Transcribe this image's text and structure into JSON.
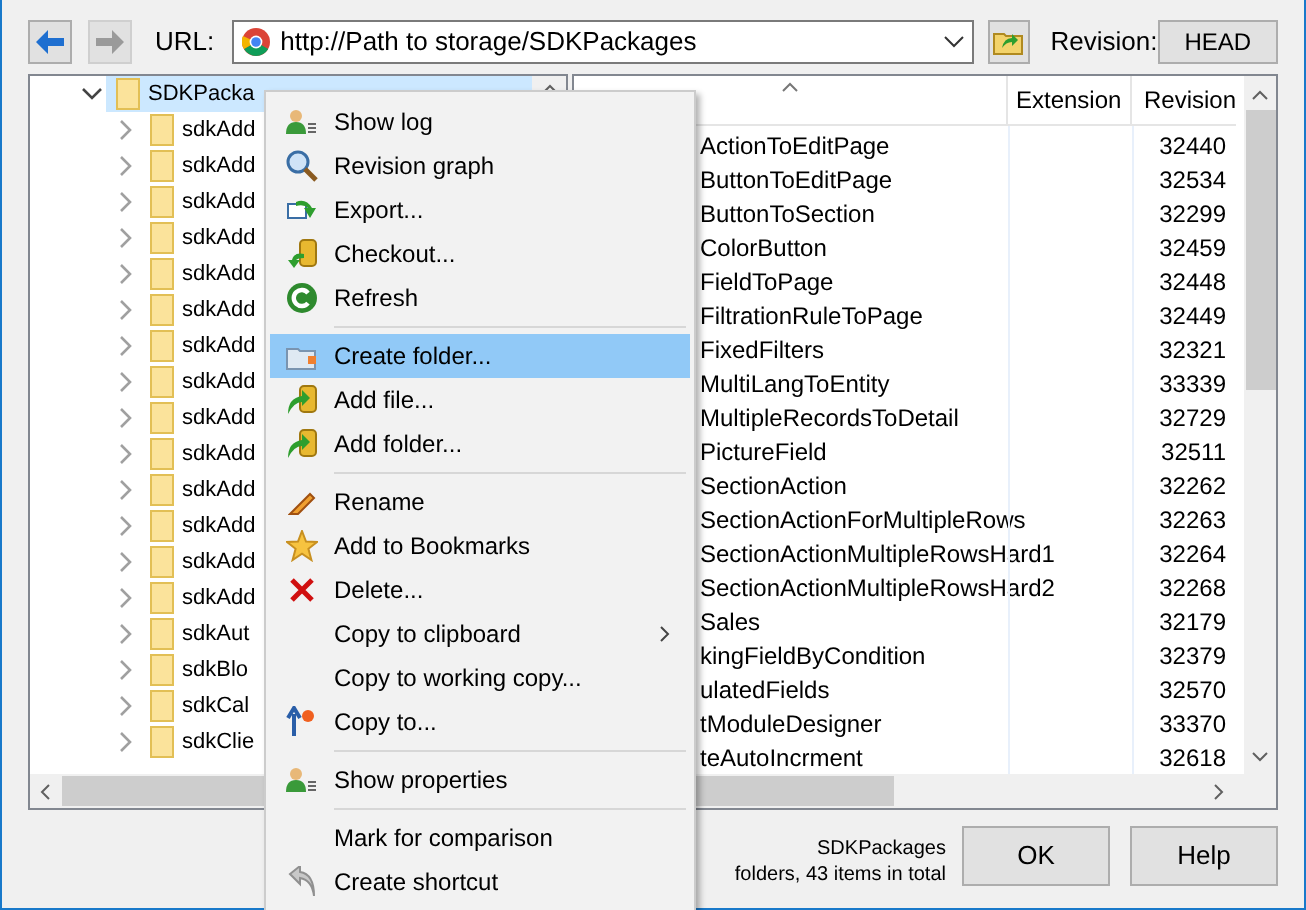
{
  "toolbar": {
    "url_label": "URL:",
    "url": "http://Path to storage/SDKPackages",
    "revision_label": "Revision:",
    "revision_button": "HEAD"
  },
  "tree": {
    "root": {
      "label": "SDKPacka",
      "expanded": true,
      "selected": true,
      "children": [
        {
          "label": "sdkAdd",
          "expanded": false,
          "selected": false
        },
        {
          "label": "sdkAdd",
          "expanded": false,
          "selected": false
        },
        {
          "label": "sdkAdd",
          "expanded": false,
          "selected": false
        },
        {
          "label": "sdkAdd",
          "expanded": false,
          "selected": false
        },
        {
          "label": "sdkAdd",
          "expanded": false,
          "selected": false
        },
        {
          "label": "sdkAdd",
          "expanded": false,
          "selected": false
        },
        {
          "label": "sdkAdd",
          "expanded": false,
          "selected": false
        },
        {
          "label": "sdkAdd",
          "expanded": false,
          "selected": false
        },
        {
          "label": "sdkAdd",
          "expanded": false,
          "selected": false
        },
        {
          "label": "sdkAdd",
          "expanded": false,
          "selected": false
        },
        {
          "label": "sdkAdd",
          "expanded": false,
          "selected": false
        },
        {
          "label": "sdkAdd",
          "expanded": false,
          "selected": false
        },
        {
          "label": "sdkAdd",
          "expanded": false,
          "selected": false
        },
        {
          "label": "sdkAdd",
          "expanded": false,
          "selected": false
        },
        {
          "label": "sdkAut",
          "expanded": false,
          "selected": false
        },
        {
          "label": "sdkBlo",
          "expanded": false,
          "selected": false
        },
        {
          "label": "sdkCal",
          "expanded": false,
          "selected": false
        },
        {
          "label": "sdkClie",
          "expanded": false,
          "selected": false
        }
      ]
    }
  },
  "list": {
    "columns": [
      "Extension",
      "Revision"
    ],
    "rows": [
      {
        "name": "ActionToEditPage",
        "revision": "32440"
      },
      {
        "name": "ButtonToEditPage",
        "revision": "32534"
      },
      {
        "name": "ButtonToSection",
        "revision": "32299"
      },
      {
        "name": "ColorButton",
        "revision": "32459"
      },
      {
        "name": "FieldToPage",
        "revision": "32448"
      },
      {
        "name": "FiltrationRuleToPage",
        "revision": "32449"
      },
      {
        "name": "FixedFilters",
        "revision": "32321"
      },
      {
        "name": "MultiLangToEntity",
        "revision": "33339"
      },
      {
        "name": "MultipleRecordsToDetail",
        "revision": "32729"
      },
      {
        "name": "PictureField",
        "revision": "32511"
      },
      {
        "name": "SectionAction",
        "revision": "32262"
      },
      {
        "name": "SectionActionForMultipleRows",
        "revision": "32263"
      },
      {
        "name": "SectionActionMultipleRowsHard1",
        "revision": "32264"
      },
      {
        "name": "SectionActionMultipleRowsHard2",
        "revision": "32268"
      },
      {
        "name": "Sales",
        "revision": "32179"
      },
      {
        "name": "kingFieldByCondition",
        "revision": "32379"
      },
      {
        "name": "ulatedFields",
        "revision": "32570"
      },
      {
        "name": "tModuleDesigner",
        "revision": "33370"
      },
      {
        "name": "teAutoIncrment",
        "revision": "32618"
      }
    ]
  },
  "status": [
    "SDKPackages",
    "folders, 43 items in total"
  ],
  "buttons": [
    "OK",
    "Help"
  ],
  "context_menu": [
    {
      "kind": "item",
      "label": "Show log",
      "selected": false
    },
    {
      "kind": "item",
      "label": "Revision graph",
      "selected": false
    },
    {
      "kind": "item",
      "label": "Export...",
      "selected": false
    },
    {
      "kind": "item",
      "label": "Checkout...",
      "selected": false
    },
    {
      "kind": "item",
      "label": "Refresh",
      "selected": false
    },
    {
      "kind": "separator"
    },
    {
      "kind": "item",
      "label": "Create folder...",
      "selected": true
    },
    {
      "kind": "item",
      "label": "Add file...",
      "selected": false
    },
    {
      "kind": "item",
      "label": "Add folder...",
      "selected": false
    },
    {
      "kind": "separator"
    },
    {
      "kind": "item",
      "label": "Rename",
      "selected": false
    },
    {
      "kind": "item",
      "label": "Add to Bookmarks",
      "selected": false
    },
    {
      "kind": "item",
      "label": "Delete...",
      "selected": false
    },
    {
      "kind": "submenu",
      "label": "Copy to clipboard",
      "selected": false
    },
    {
      "kind": "item",
      "label": "Copy to working copy...",
      "selected": false
    },
    {
      "kind": "item",
      "label": "Copy to...",
      "selected": false
    },
    {
      "kind": "separator"
    },
    {
      "kind": "item",
      "label": "Show properties",
      "selected": false
    },
    {
      "kind": "separator"
    },
    {
      "kind": "item",
      "label": "Mark for comparison",
      "selected": false
    },
    {
      "kind": "item",
      "label": "Create shortcut",
      "selected": false
    }
  ]
}
